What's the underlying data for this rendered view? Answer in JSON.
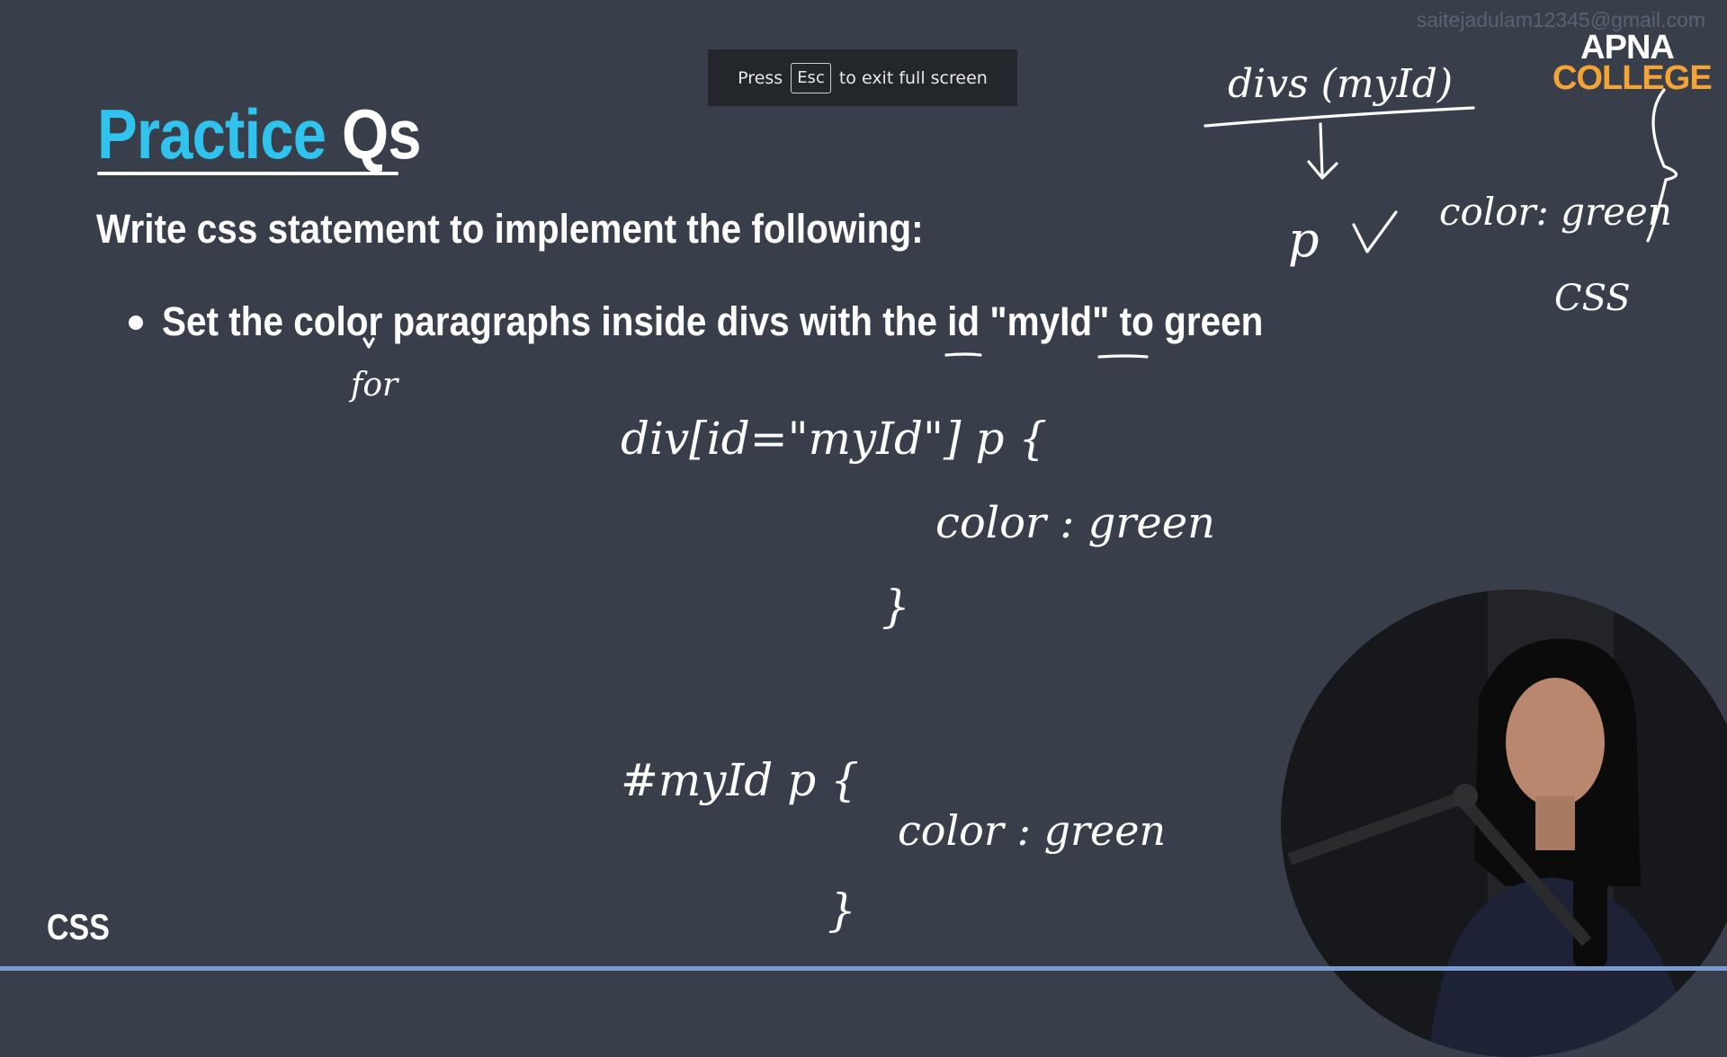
{
  "toast": {
    "press": "Press",
    "key": "Esc",
    "suffix": "to exit full screen"
  },
  "slide": {
    "title_part1": "Practice",
    "title_part2": "Qs",
    "subtitle": "Write css statement to implement the following:",
    "bullet": "Set the color paragraphs inside divs with the id \"myId\" to green",
    "footer_label": "CSS"
  },
  "watermark": {
    "email": "saitejadulam12345@gmail.com"
  },
  "logo": {
    "line1": "APNA",
    "line2": "COLLEGE"
  },
  "handwriting": {
    "insert_word": "for",
    "code1_selector": "div[id=\"myId\"]  p  {",
    "code1_rule": "color : green",
    "code1_close": "}",
    "code2_selector": "#myId   p  {",
    "code2_rule": "color : green",
    "code2_close": "}",
    "diagram_top": "divs (myId)",
    "diagram_p": "p",
    "diagram_rule": "color: green",
    "diagram_label": "CSS"
  },
  "colors": {
    "background": "#393f4a",
    "title_accent": "#2fc3ee",
    "logo_accent": "#f4a436"
  }
}
